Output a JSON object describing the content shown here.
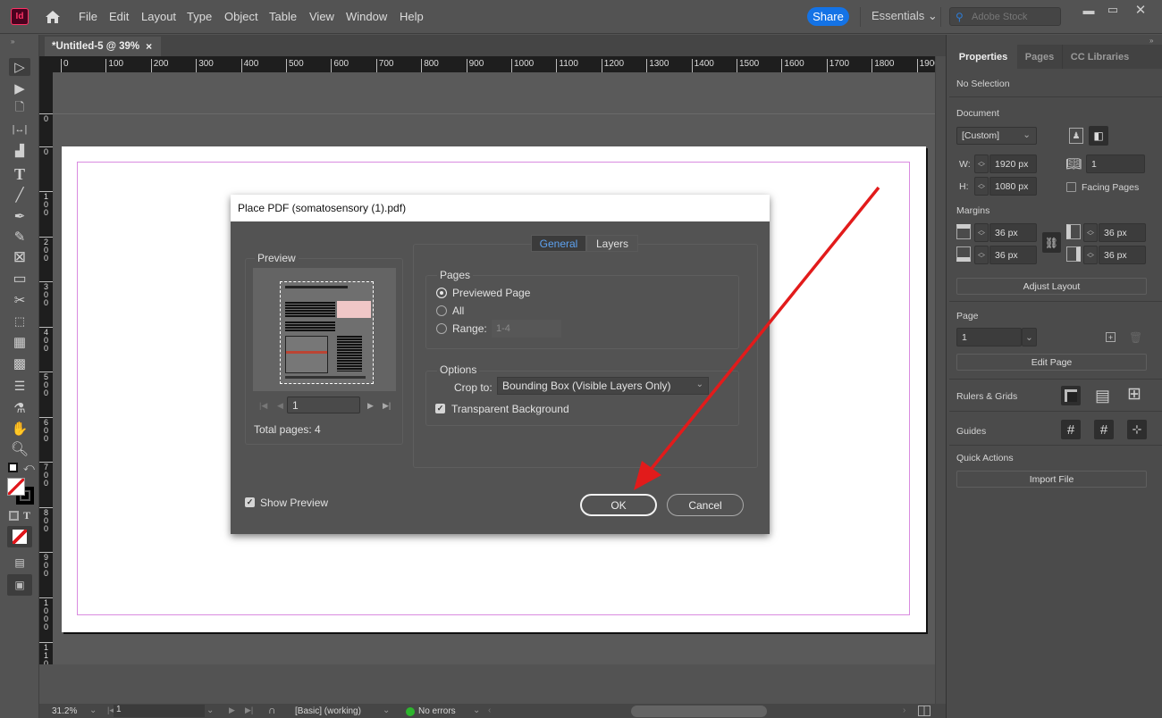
{
  "app": {
    "logo": "Id",
    "home_icon": "home-icon"
  },
  "menu": [
    "File",
    "Edit",
    "Layout",
    "Type",
    "Object",
    "Table",
    "View",
    "Window",
    "Help"
  ],
  "header": {
    "share_label": "Share",
    "workspace": "Essentials",
    "search_placeholder": "Adobe Stock",
    "window_controls": {
      "minimize": "minimize-icon",
      "maximize": "maximize-icon",
      "close": "close-icon"
    }
  },
  "document_tab": {
    "title": "*Untitled-5 @ 39%",
    "close": "×"
  },
  "rulers": {
    "horizontal": [
      "0",
      "100",
      "200",
      "300",
      "400",
      "500",
      "600",
      "700",
      "800",
      "900",
      "1000",
      "1100",
      "1200",
      "1300",
      "1400",
      "1500",
      "1600",
      "1700",
      "1800",
      "1900"
    ],
    "vertical": [
      "0",
      "0",
      "100",
      "200",
      "300",
      "400",
      "500",
      "600",
      "700",
      "800",
      "900",
      "1000",
      "110"
    ]
  },
  "tools": [
    "selection",
    "direct-selection",
    "page",
    "gap",
    "content-collector",
    "type",
    "line",
    "pen",
    "pencil",
    "rectangle-frame",
    "rectangle",
    "scissors",
    "free-transform",
    "gradient-swatch",
    "gradient-feather",
    "note",
    "eyedropper",
    "hand",
    "zoom",
    "default-fill-stroke",
    "swap-fill-stroke",
    "fill-stroke",
    "formatting-container",
    "formatting-text",
    "apply-none",
    "screen-mode",
    "preview-mode"
  ],
  "panel": {
    "tabs": [
      "Properties",
      "Pages",
      "CC Libraries"
    ],
    "active_tab": "Properties",
    "selection": "No Selection",
    "document": {
      "heading": "Document",
      "preset": "[Custom]",
      "width_label": "W:",
      "width": "1920 px",
      "height_label": "H:",
      "height": "1080 px",
      "pages": "1",
      "facing_pages_label": "Facing Pages",
      "facing_pages": false
    },
    "margins": {
      "heading": "Margins",
      "top": "36 px",
      "bottom": "36 px",
      "left": "36 px",
      "right": "36 px",
      "adjust_label": "Adjust Layout"
    },
    "page": {
      "heading": "Page",
      "value": "1",
      "edit_label": "Edit Page"
    },
    "rulers_grids": "Rulers & Grids",
    "guides": "Guides",
    "quick_actions": {
      "heading": "Quick Actions",
      "import_label": "Import File"
    }
  },
  "dialog": {
    "title": "Place PDF (somatosensory (1).pdf)",
    "preview_heading": "Preview",
    "page_input": "1",
    "total_pages": "Total pages: 4",
    "tabs": [
      "General",
      "Layers"
    ],
    "active_tab": "General",
    "pages_heading": "Pages",
    "page_options": [
      {
        "label": "Previewed Page",
        "selected": true
      },
      {
        "label": "All",
        "selected": false
      },
      {
        "label": "Range:",
        "selected": false
      }
    ],
    "range_value": "1-4",
    "options_heading": "Options",
    "crop_label": "Crop to:",
    "crop_value": "Bounding Box (Visible Layers Only)",
    "transparent_bg_label": "Transparent Background",
    "transparent_bg": true,
    "show_preview_label": "Show Preview",
    "show_preview": true,
    "ok_label": "OK",
    "cancel_label": "Cancel"
  },
  "status_bar": {
    "zoom": "31.2%",
    "page": "1",
    "style": "[Basic] (working)",
    "preflight": "No errors",
    "preflight_color": "#2db52d"
  },
  "annotation": {
    "arrow_color": "#e21b1b",
    "target": "ok-button"
  }
}
